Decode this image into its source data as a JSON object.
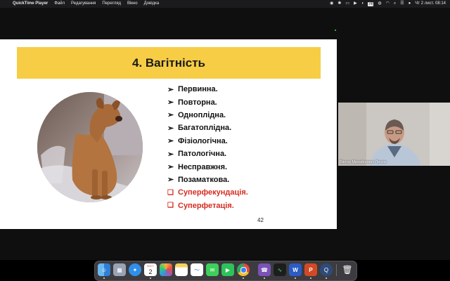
{
  "menubar": {
    "app_name": "QuickTime Player",
    "menus": [
      "Файл",
      "Редагування",
      "Перегляд",
      "Вікно",
      "Довідка"
    ],
    "keyboard_layout": "УК",
    "datetime": "Чт 2 лист.  08:14"
  },
  "slide": {
    "title": "4. Вагітність",
    "items": [
      {
        "text": "Первинна.",
        "style": "arrow"
      },
      {
        "text": "Повторна.",
        "style": "arrow"
      },
      {
        "text": "Одноплідна.",
        "style": "arrow"
      },
      {
        "text": "Багатоплідна.",
        "style": "arrow"
      },
      {
        "text": "Фізіологічна.",
        "style": "arrow"
      },
      {
        "text": "Патологічна.",
        "style": "arrow"
      },
      {
        "text": "Несправжня.",
        "style": "arrow"
      },
      {
        "text": "Позаматкова.",
        "style": "arrow"
      },
      {
        "text": "Суперфекундація.",
        "style": "box-red"
      },
      {
        "text": "Суперфетація.",
        "style": "box-red"
      }
    ],
    "page_number": "42",
    "arrow_marker": "➢",
    "box_marker": "❑",
    "banner_color": "#f6cd45",
    "accent_red": "#d62c20"
  },
  "webcam": {
    "participant_name": "Віктор Михайлович Лисюк"
  },
  "dock": {
    "calendar_day": "2",
    "calendar_month": "ЛИСТ.",
    "apps": [
      "finder-icon",
      "launchpad-icon",
      "safari-icon",
      "calendar-icon",
      "photos-icon",
      "notes-icon",
      "freeform-icon",
      "messages-icon",
      "facetime-icon",
      "chrome-icon",
      "viber-icon",
      "activity-monitor-icon",
      "word-icon",
      "powerpoint-icon",
      "quicktime-icon",
      "trash-icon"
    ]
  }
}
